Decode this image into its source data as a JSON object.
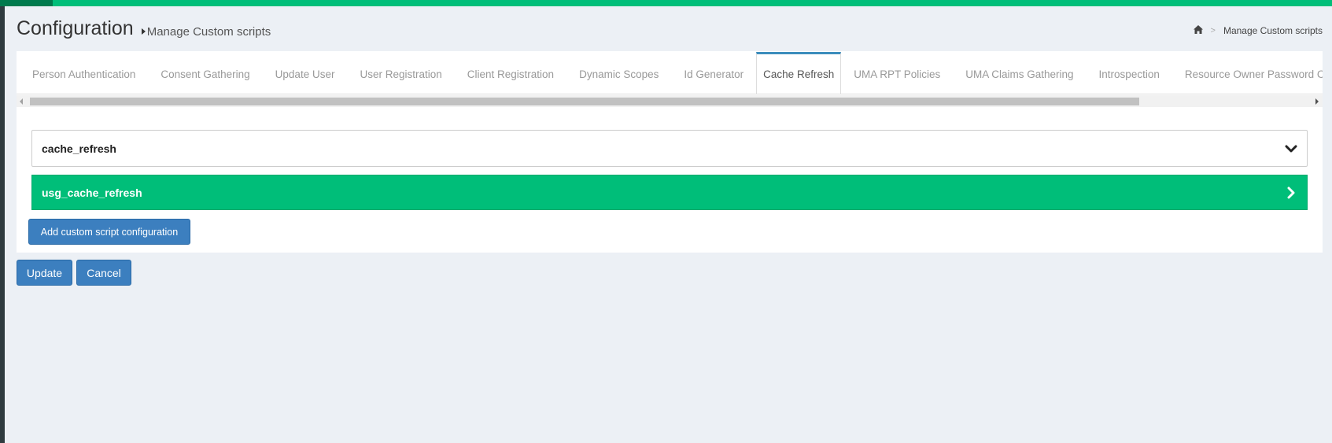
{
  "header": {
    "title": "Configuration",
    "subtitle": "Manage Custom scripts"
  },
  "breadcrumb": {
    "home_icon": "home-icon",
    "separator": ">",
    "current": "Manage Custom scripts"
  },
  "tabs": [
    {
      "label": "Person Authentication",
      "active": false
    },
    {
      "label": "Consent Gathering",
      "active": false
    },
    {
      "label": "Update User",
      "active": false
    },
    {
      "label": "User Registration",
      "active": false
    },
    {
      "label": "Client Registration",
      "active": false
    },
    {
      "label": "Dynamic Scopes",
      "active": false
    },
    {
      "label": "Id Generator",
      "active": false
    },
    {
      "label": "Cache Refresh",
      "active": true
    },
    {
      "label": "UMA RPT Policies",
      "active": false
    },
    {
      "label": "UMA Claims Gathering",
      "active": false
    },
    {
      "label": "Introspection",
      "active": false
    },
    {
      "label": "Resource Owner Password Credentials",
      "active": false
    }
  ],
  "scripts": [
    {
      "name": "cache_refresh",
      "expanded": true,
      "icon": "chevron-down-icon"
    },
    {
      "name": "usg_cache_refresh",
      "expanded": false,
      "icon": "chevron-right-icon"
    }
  ],
  "buttons": {
    "add_config": "Add custom script configuration",
    "update": "Update",
    "cancel": "Cancel"
  },
  "colors": {
    "accent_green": "#00be79",
    "primary_blue": "#3c7fbf",
    "active_tab_border": "#3c8dbc"
  }
}
